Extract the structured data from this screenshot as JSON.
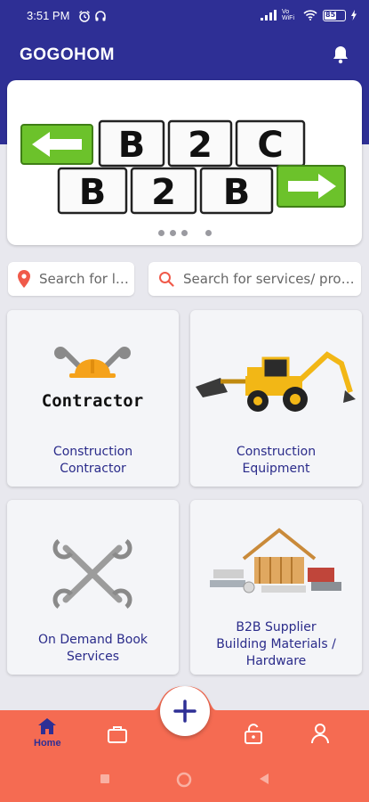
{
  "status_bar": {
    "time": "3:51 PM",
    "network_label": "Vo WiFi",
    "battery_level": "85"
  },
  "app_bar": {
    "title": "GOGOHOM"
  },
  "banner": {
    "row1_tiles": [
      "B",
      "2",
      "C"
    ],
    "row2_tiles": [
      "B",
      "2",
      "B"
    ],
    "dots": 4,
    "active_dot": 3
  },
  "search": {
    "location_placeholder": "Search for location",
    "services_placeholder": "Search for services/ products"
  },
  "categories": [
    {
      "image_text": "Contractor",
      "label_line1": "Construction",
      "label_line2": "Contractor"
    },
    {
      "label_line1": "Construction",
      "label_line2": "Equipment"
    },
    {
      "label_line1": "On Demand Book",
      "label_line2": "Services"
    },
    {
      "label_line1": "B2B Supplier",
      "label_line2": "Building Materials /",
      "label_line3": "Hardware"
    }
  ],
  "bottom_nav": {
    "home_label": "Home"
  },
  "colors": {
    "primary": "#2e2f95",
    "accent": "#f56b52",
    "card_text": "#2a2b8a",
    "pin": "#f05a4a"
  }
}
